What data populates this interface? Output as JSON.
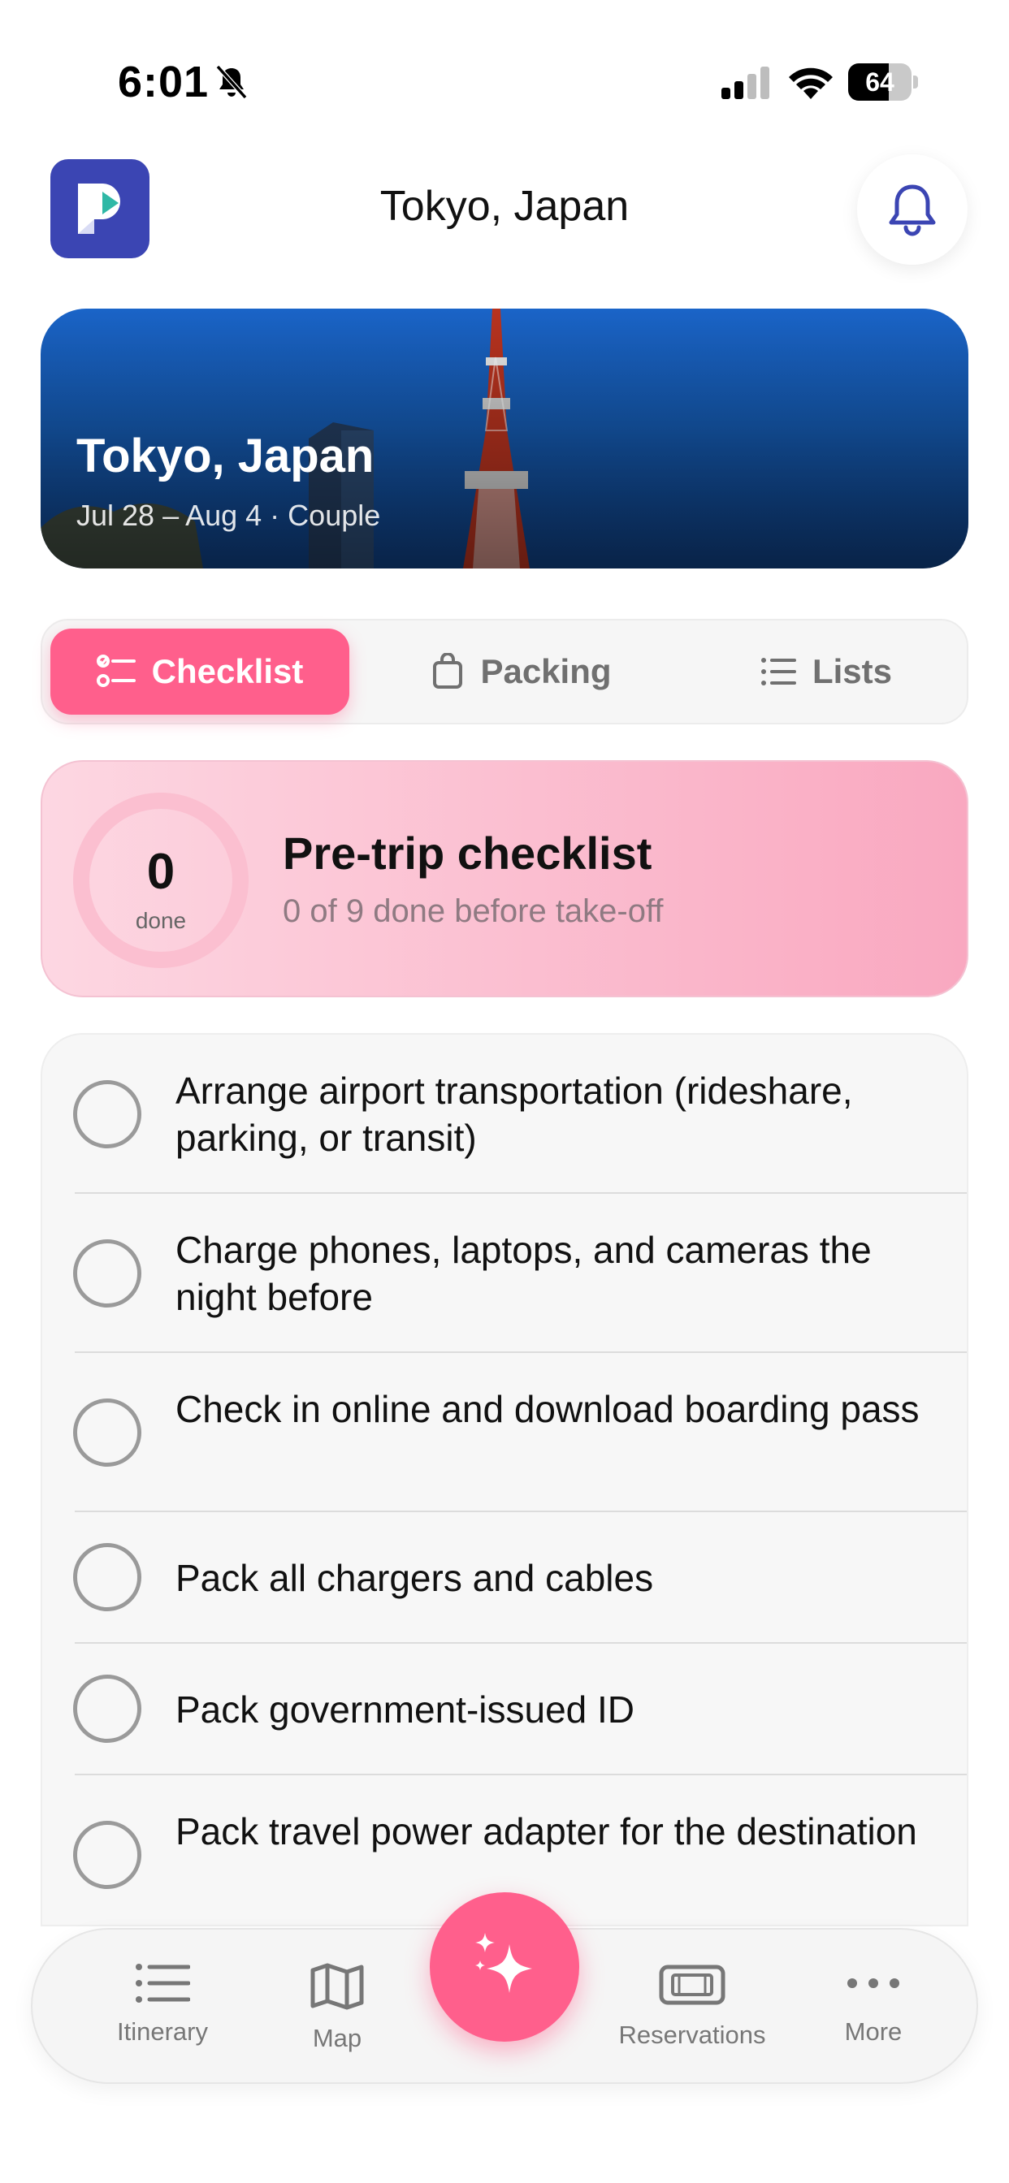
{
  "status_bar": {
    "time": "6:01",
    "battery_level": "64",
    "battery_fraction": 0.64
  },
  "header": {
    "title": "Tokyo, Japan"
  },
  "hero": {
    "title": "Tokyo, Japan",
    "subtitle": "Jul 28 – Aug 4 · Couple"
  },
  "tabs": [
    {
      "label": "Checklist",
      "active": true
    },
    {
      "label": "Packing",
      "active": false
    },
    {
      "label": "Lists",
      "active": false
    }
  ],
  "progress": {
    "count": "0",
    "count_label": "done",
    "title": "Pre-trip checklist",
    "subtitle": "0 of 9 done before take-off"
  },
  "checklist": {
    "items": [
      {
        "text": "Arrange airport transportation (rideshare, parking, or transit)",
        "checked": false
      },
      {
        "text": "Charge phones, laptops, and cameras the night before",
        "checked": false
      },
      {
        "text": "Check in online and download boarding pass",
        "checked": false
      },
      {
        "text": "Pack all chargers and cables",
        "checked": false
      },
      {
        "text": "Pack government-issued ID",
        "checked": false
      },
      {
        "text": "Pack travel power adapter for the destination",
        "checked": false
      }
    ]
  },
  "bottom_nav": {
    "items": [
      {
        "label": "Itinerary",
        "icon": "list-icon"
      },
      {
        "label": "Map",
        "icon": "map-icon"
      },
      {
        "label": "Reservations",
        "icon": "ticket-icon"
      },
      {
        "label": "More",
        "icon": "more-icon"
      }
    ],
    "fab_icon": "sparkles-icon"
  },
  "colors": {
    "accent": "#ff5f8c",
    "brand": "#3b45b3",
    "hero_blue": "#1a64c8",
    "card_pink": "#f9a8c0"
  }
}
